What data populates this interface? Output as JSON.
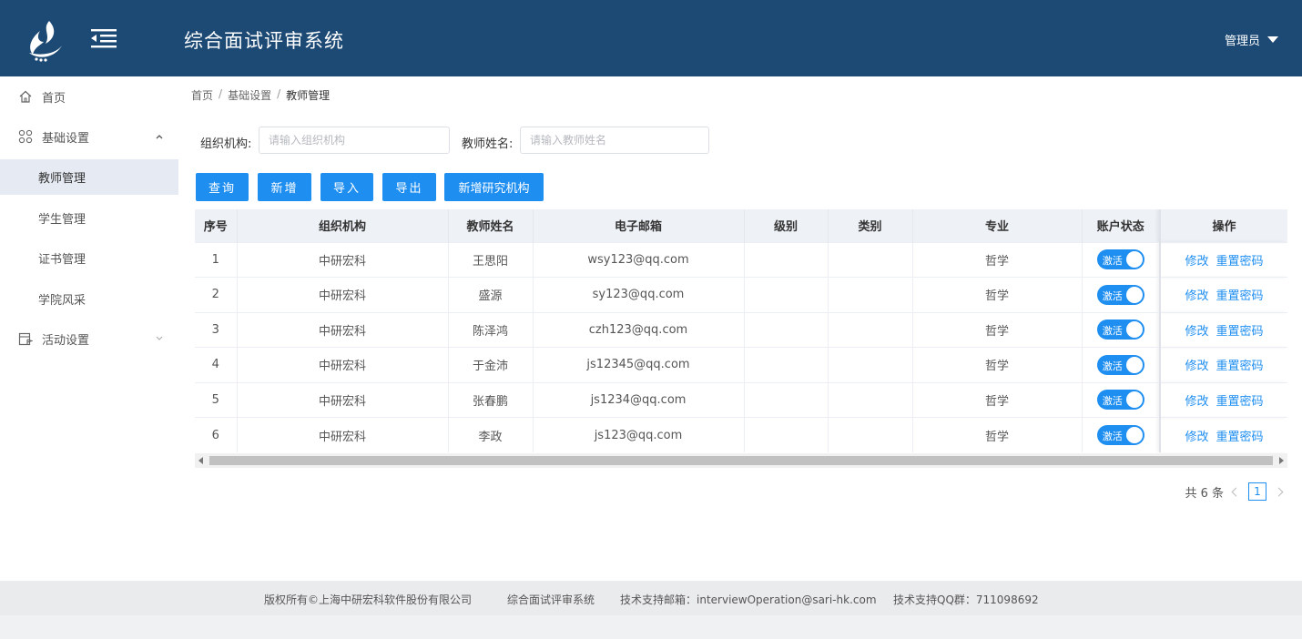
{
  "header": {
    "title": "综合面试评审系统",
    "user": "管理员"
  },
  "sidebar": {
    "home": "首页",
    "basic_settings": "基础设置",
    "teacher_mgmt": "教师管理",
    "student_mgmt": "学生管理",
    "cert_mgmt": "证书管理",
    "college_style": "学院风采",
    "activity_settings": "活动设置"
  },
  "breadcrumb": [
    "首页",
    "/",
    "基础设置",
    "/",
    "教师管理"
  ],
  "filters": {
    "org_label": "组织机构:",
    "org_placeholder": "请输入组织机构",
    "name_label": "教师姓名:",
    "name_placeholder": "请输入教师姓名"
  },
  "buttons": {
    "query": "查询",
    "add": "新增",
    "import": "导入",
    "export": "导出",
    "add_institute": "新增研究机构"
  },
  "table": {
    "columns": [
      "序号",
      "组织机构",
      "教师姓名",
      "电子邮箱",
      "级别",
      "类别",
      "专业",
      "账户状态",
      "操作"
    ],
    "rows": [
      {
        "no": "1",
        "org": "中研宏科",
        "name": "王思阳",
        "email": "wsy123@qq.com",
        "level": "",
        "category": "",
        "major": "哲学",
        "status": "激活"
      },
      {
        "no": "2",
        "org": "中研宏科",
        "name": "盛源",
        "email": "sy123@qq.com",
        "level": "",
        "category": "",
        "major": "哲学",
        "status": "激活"
      },
      {
        "no": "3",
        "org": "中研宏科",
        "name": "陈泽鸿",
        "email": "czh123@qq.com",
        "level": "",
        "category": "",
        "major": "哲学",
        "status": "激活"
      },
      {
        "no": "4",
        "org": "中研宏科",
        "name": "于金沛",
        "email": "js12345@qq.com",
        "level": "",
        "category": "",
        "major": "哲学",
        "status": "激活"
      },
      {
        "no": "5",
        "org": "中研宏科",
        "name": "张春鹏",
        "email": "js1234@qq.com",
        "level": "",
        "category": "",
        "major": "哲学",
        "status": "激活"
      },
      {
        "no": "6",
        "org": "中研宏科",
        "name": "李政",
        "email": "js123@qq.com",
        "level": "",
        "category": "",
        "major": "哲学",
        "status": "激活"
      }
    ],
    "op_edit": "修改",
    "op_reset": "重置密码"
  },
  "pagination": {
    "total": "共 6 条",
    "current": "1"
  },
  "footer": {
    "copyright": "版权所有©上海中研宏科软件股份有限公司",
    "system": "综合面试评审系统",
    "email": "技术支持邮箱：interviewOperation@sari-hk.com",
    "qq": "技术支持QQ群：711098692"
  },
  "colors": {
    "header_bg": "#1d4a75",
    "primary": "#1e8ef0",
    "active_menu_bg": "#e6eaf2"
  },
  "icons": {
    "logo": "flame-logo-icon",
    "menu_toggle": "menu-fold-icon",
    "home": "home-icon",
    "basic_settings": "grid-icon",
    "activity": "calendar-flag-icon"
  }
}
